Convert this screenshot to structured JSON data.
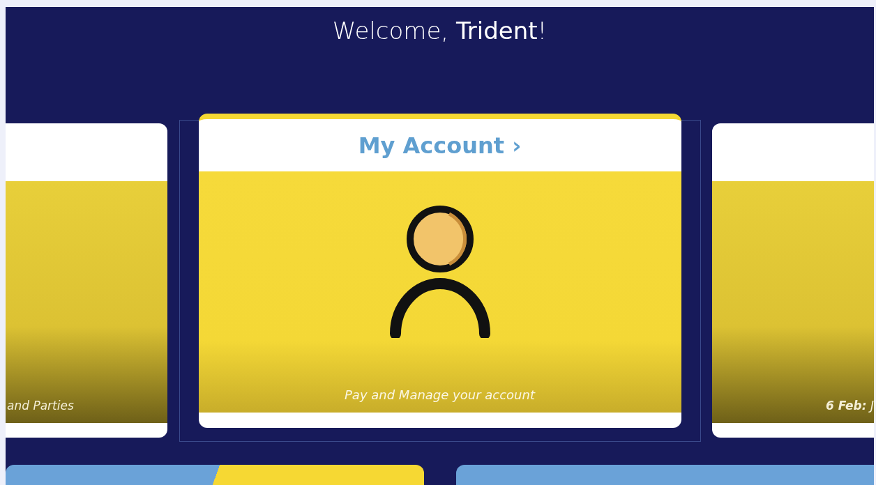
{
  "welcome": "Welcome, **Trident**!",
  "cards": [
    {
      "selected": false,
      "caption": "and Parties"
    },
    {
      "selected": true,
      "title": "My Account ›",
      "caption": "Pay and Manage your account"
    },
    {
      "selected": false,
      "caption": "**6 Feb:**  J"
    }
  ]
}
